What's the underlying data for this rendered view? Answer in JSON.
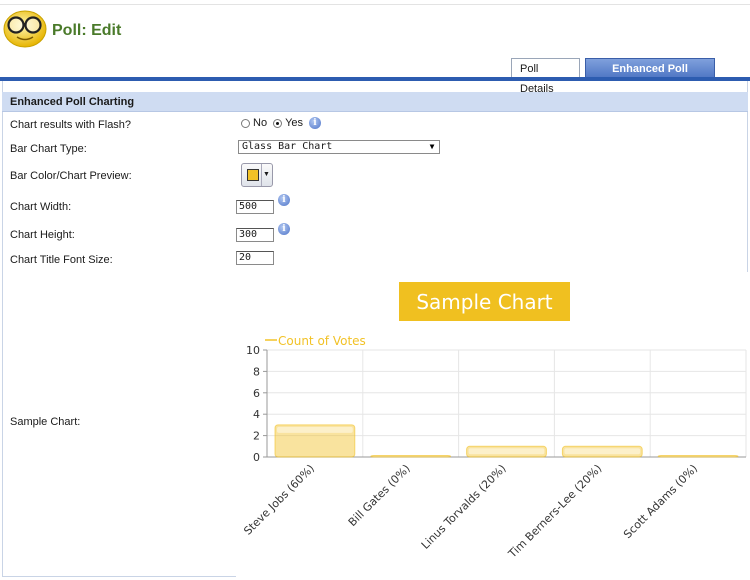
{
  "page": {
    "title": "Poll: Edit"
  },
  "tabs": [
    {
      "label": "Poll Details",
      "active": false
    },
    {
      "label": "Enhanced Poll Charting",
      "active": true
    }
  ],
  "section": {
    "title": "Enhanced Poll Charting"
  },
  "fields": {
    "flash": {
      "label": "Chart results with Flash?",
      "options": [
        "No",
        "Yes"
      ],
      "selected": "Yes"
    },
    "bar_type": {
      "label": "Bar Chart Type:",
      "value": "Glass Bar Chart"
    },
    "bar_color": {
      "label": "Bar Color/Chart Preview:",
      "color": "#f2c227"
    },
    "width": {
      "label": "Chart Width:",
      "value": "500"
    },
    "height": {
      "label": "Chart Height:",
      "value": "300"
    },
    "title_font": {
      "label": "Chart Title Font Size:",
      "value": "20"
    },
    "sample": {
      "label": "Sample Chart:"
    }
  },
  "chart_data": {
    "type": "bar",
    "title": "Sample Chart",
    "legend": "Count of Votes",
    "legend_position": "top-left",
    "categories": [
      "Steve Jobs (60%)",
      "Bill Gates (0%)",
      "Linus Torvalds (20%)",
      "Tim Berners-Lee (20%)",
      "Scott Adams (0%)"
    ],
    "series": [
      {
        "name": "Count of Votes",
        "values": [
          3,
          0,
          1,
          1,
          0
        ]
      }
    ],
    "y_ticks": [
      0,
      2,
      4,
      6,
      8,
      10
    ],
    "ylim": [
      0,
      10
    ],
    "grid": true,
    "bar_color": "#f2c227",
    "title_bg": "#f0c020"
  },
  "colors": {
    "accent": "#2d5cb0",
    "title": "#4a7a2a"
  }
}
